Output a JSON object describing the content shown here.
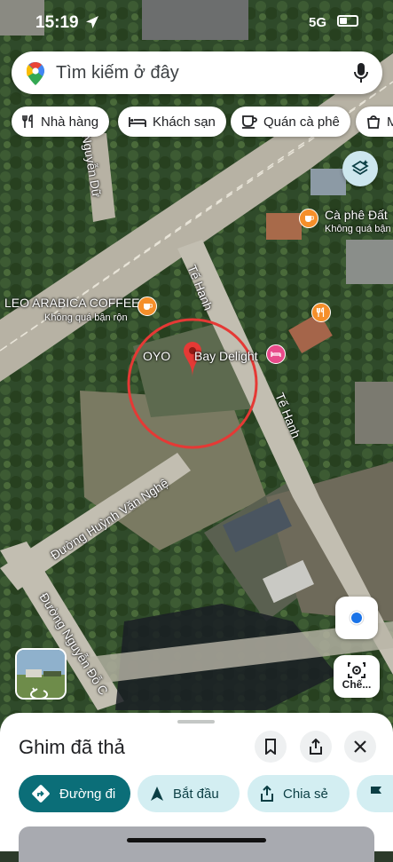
{
  "status": {
    "time": "15:19",
    "network": "5G"
  },
  "search": {
    "placeholder": "Tìm kiếm ở đây"
  },
  "chips": [
    {
      "label": "Nhà hàng",
      "icon": "fork-knife-icon"
    },
    {
      "label": "Khách sạn",
      "icon": "bed-icon"
    },
    {
      "label": "Quán cà phê",
      "icon": "coffee-cup-icon"
    },
    {
      "label": "M",
      "icon": "shopping-bag-icon"
    }
  ],
  "map": {
    "streets": [
      "Nguyễn Dữ",
      "Tế Hanh",
      "Tế Hanh",
      "Đường Huỳnh Văn Nghệ",
      "Đường Nguyễn Đỗ C"
    ],
    "places": [
      {
        "name": "LEO ARABICA COFFEE",
        "note": "Không quá bận rộn",
        "icon": "coffee-icon"
      },
      {
        "name": "Cà phê Đất",
        "note": "Không quá bận",
        "icon": "coffee-icon"
      },
      {
        "name": "OYO",
        "icon": "restaurant-icon"
      },
      {
        "name": "Bay Delight",
        "icon": "hotel-icon"
      }
    ],
    "colors": {
      "pin": "#e53935",
      "circle": "#e53935",
      "road": "#c9c4b8"
    }
  },
  "controls": {
    "lens_label": "Chế..."
  },
  "sheet": {
    "title": "Ghim đã thả",
    "actions": [
      {
        "label": "Đường đi",
        "icon": "directions-icon"
      },
      {
        "label": "Bắt đầu",
        "icon": "navigation-arrow-icon"
      },
      {
        "label": "Chia sẻ",
        "icon": "share-icon"
      },
      {
        "label": "",
        "icon": "flag-icon"
      }
    ]
  }
}
